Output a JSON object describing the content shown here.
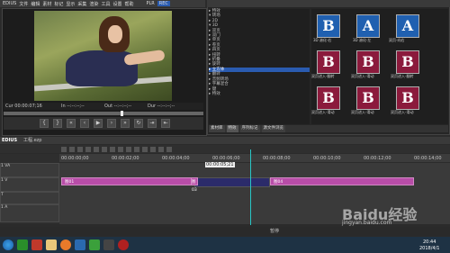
{
  "player": {
    "menu": [
      "EDIUS",
      "文件",
      "编辑",
      "素材",
      "标记",
      "显示",
      "采集",
      "渲染",
      "工具",
      "设置",
      "帮助"
    ],
    "plr_label": "PLR",
    "rec_label": "REC",
    "tc_cur": "Cur 00:00:07;16",
    "tc_in": "In --:--:--;--",
    "tc_out": "Out --:--:--;--",
    "tc_dur": "Dur --:--:--;--"
  },
  "effects": {
    "tree": [
      "▸ 特效",
      "  ▾ 转场",
      "    ▸ 2D",
      "    ▾ 3D",
      "      ▸ 双页",
      "      ▸ 双门",
      "      ▸ 单页",
      "      ▸ 卷页",
      "      ▸ 四页",
      "      ▸ 扭转",
      "      ▸ 折叠",
      "      ▸ 旋转",
      "      ▸ 立方体",
      "      ▸ 翻转",
      "  ▸ 音频转场",
      "  ▸ 字幕混合",
      "  ▸ 键",
      "  ▸ 特效"
    ],
    "thumbs": [
      {
        "letter": "B",
        "color": "blue",
        "label": "3D 溶化-右"
      },
      {
        "letter": "A",
        "color": "blue",
        "label": "3D 溶化-左"
      },
      {
        "letter": "A",
        "color": "blue",
        "label": "双页-向右"
      },
      {
        "letter": "B",
        "color": "red",
        "label": "双页进入-翻转"
      },
      {
        "letter": "B",
        "color": "red",
        "label": "双页进入-滑动"
      },
      {
        "letter": "B",
        "color": "red",
        "label": "双页进入-翻转"
      },
      {
        "letter": "B",
        "color": "red",
        "label": "双页进入-滑动"
      },
      {
        "letter": "B",
        "color": "red",
        "label": "双页进入-滑动"
      },
      {
        "letter": "B",
        "color": "red",
        "label": "双页进入-滑动"
      }
    ],
    "tabs": [
      "素材库",
      "特效",
      "序列标记",
      "源文件浏览"
    ]
  },
  "timeline": {
    "title": "EDIUS",
    "project": "工程.ezp",
    "ruler_ticks": [
      "00:00:00;00",
      "00:00:02;00",
      "00:00:04;00",
      "00:00:06;00",
      "00:00:08;00",
      "00:00:10;00",
      "00:00:12;00",
      "00:00:14;00"
    ],
    "playhead_tc": "00:00:05;21",
    "tracks": [
      {
        "name": "1 VA",
        "label": "1 VA"
      },
      {
        "name": "1 V",
        "label": "1 V"
      },
      {
        "name": "T",
        "label": "T"
      },
      {
        "name": "1 A",
        "label": "1 A"
      }
    ],
    "clips": [
      {
        "label": "图01"
      },
      {
        "label": "图03"
      },
      {
        "label": "图04"
      }
    ],
    "status": "暂停"
  },
  "taskbar": {
    "time": "20:44",
    "date": "2018/4/1"
  },
  "watermark": {
    "text": "Baidu经验",
    "sub": "jingyan.baidu.com"
  }
}
